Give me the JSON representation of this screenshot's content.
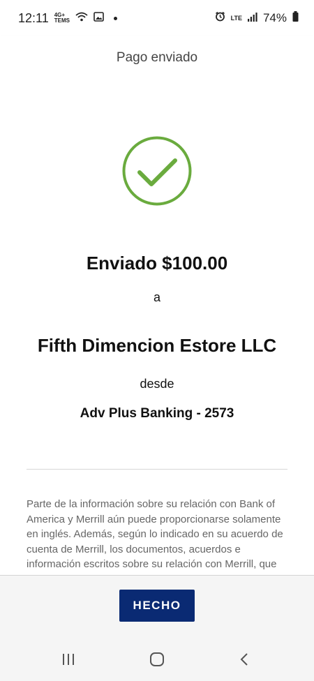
{
  "status_bar": {
    "time": "12:11",
    "carrier_badge": "4G+ TEMS",
    "network": "LTE",
    "battery": "74%"
  },
  "header": {
    "title": "Pago enviado"
  },
  "confirmation": {
    "sent_amount": "Enviado $100.00",
    "to_word": "a",
    "payee": "Fifth Dimencion Estore LLC",
    "from_word": "desde",
    "account": "Adv Plus Banking - 2573"
  },
  "disclaimer": "Parte de la información sobre su relación con Bank of America y Merrill aún puede proporcionarse solamente en inglés. Además, según lo indicado en su acuerdo de cuenta de Merrill, los documentos, acuerdos e información escritos sobre su relación con Merrill, que incluyen pero no se limitan a",
  "footer": {
    "done_label": "HECHO"
  },
  "colors": {
    "accent": "#0a2a73",
    "success": "#6aab3e"
  }
}
